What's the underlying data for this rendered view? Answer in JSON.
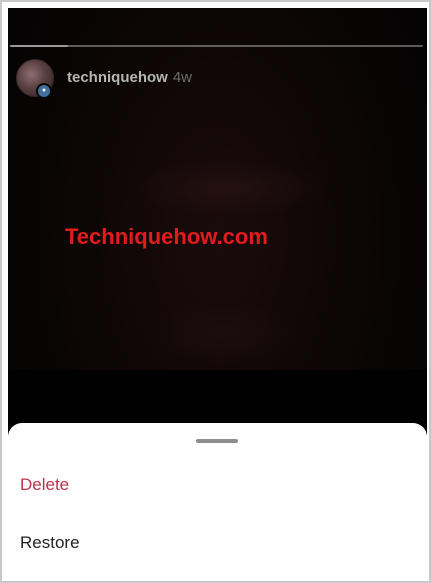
{
  "story": {
    "username": "techniquehow",
    "posted_ago": "4w",
    "watermark": "Techniquehow.com",
    "progress": 0.14
  },
  "sheet": {
    "options": [
      {
        "label": "Delete",
        "color": "#c0304a"
      },
      {
        "label": "Restore",
        "color": "#222222"
      }
    ]
  },
  "icons": {
    "avatar_badge": "profile-badge-icon"
  },
  "colors": {
    "story_background": "#060404",
    "watermark": "#e21b1b",
    "destructive": "#c0304a"
  }
}
